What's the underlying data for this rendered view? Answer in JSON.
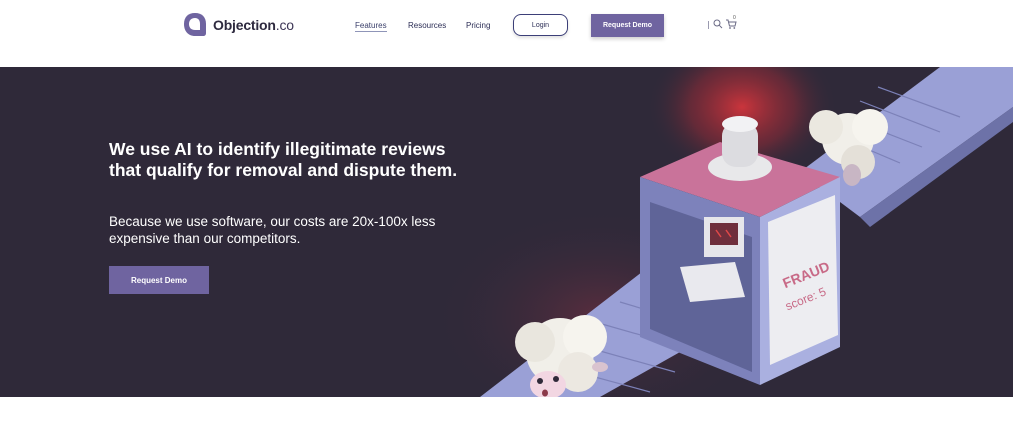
{
  "header": {
    "logo_text": "Objection",
    "logo_tld": ".co",
    "nav": [
      {
        "label": "Features",
        "active": true
      },
      {
        "label": "Resources",
        "active": false
      },
      {
        "label": "Pricing",
        "active": false
      }
    ],
    "login_label": "Login",
    "demo_label": "Request Demo",
    "cart_count": "0",
    "icons": [
      "logo-icon",
      "search-icon",
      "cart-icon"
    ]
  },
  "hero": {
    "headline": "We use AI to identify illegitimate reviews that qualify for removal and dispute them.",
    "subline": "Because we use software, our costs are 20x-100x less expensive than our competitors.",
    "cta_label": "Request Demo",
    "illustration": {
      "sign_line1": "FRAUD",
      "sign_line2": "score: 5"
    }
  },
  "colors": {
    "brand": "#6f64a0",
    "hero_bg": "#2f2939",
    "nav_text": "#2b2d55",
    "conveyor": "#8d92c9",
    "machine_top": "#c9739a",
    "alarm_glow": "#c0373e"
  }
}
